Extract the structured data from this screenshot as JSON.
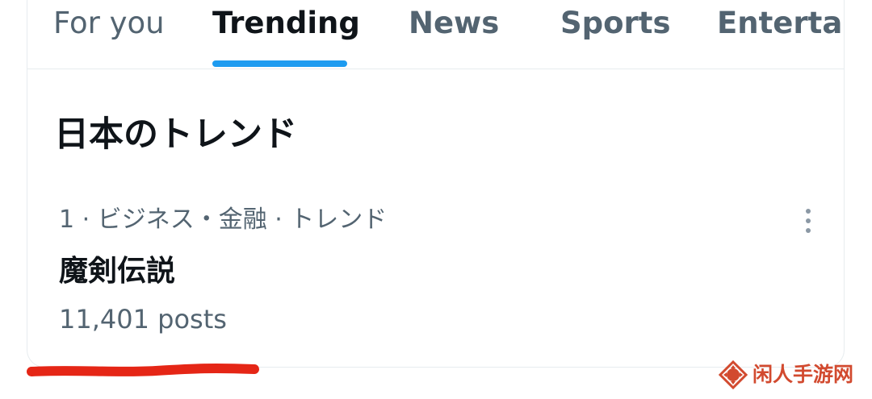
{
  "tabs": [
    {
      "label": "For you",
      "active": false
    },
    {
      "label": "Trending",
      "active": true
    },
    {
      "label": "News",
      "active": false
    },
    {
      "label": "Sports",
      "active": false
    },
    {
      "label": "Entertai",
      "active": false
    }
  ],
  "section": {
    "title": "日本のトレンド"
  },
  "trend": {
    "meta": "1 · ビジネス・金融 · トレンド",
    "name": "魔剣伝説",
    "count": "11,401 posts"
  },
  "icons": {
    "more": "more-vertical-icon",
    "watermark": "diamond-logo-icon"
  },
  "colors": {
    "active_text": "#0f1419",
    "secondary_text": "#536471",
    "accent": "#1d9bf0",
    "annotation": "#e52616",
    "watermark": "#d24a2f"
  },
  "watermark": {
    "text": "闲人手游网"
  }
}
